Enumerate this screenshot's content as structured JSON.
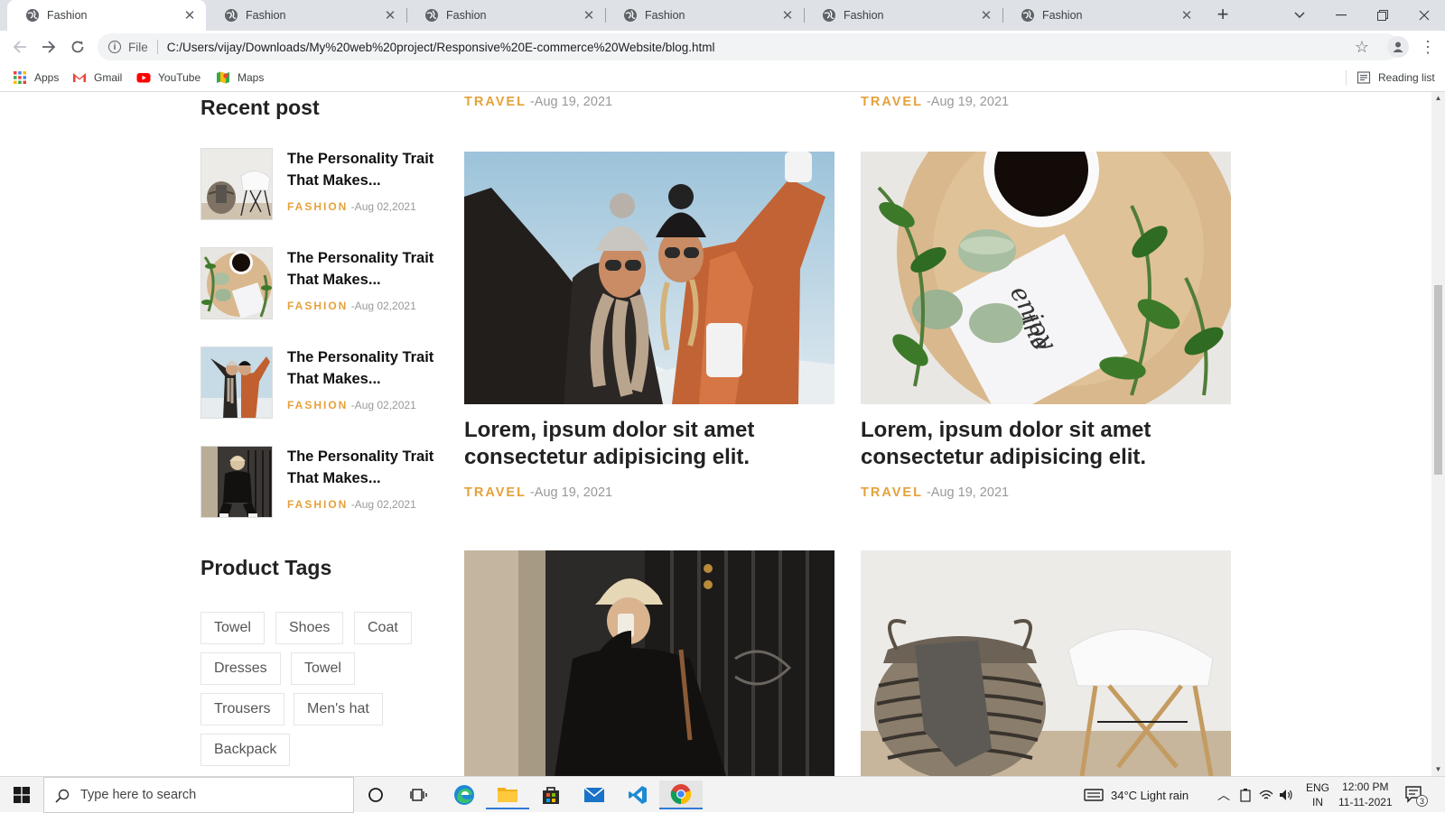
{
  "browser": {
    "tabs": [
      {
        "title": "Fashion",
        "active": true
      },
      {
        "title": "Fashion",
        "active": false
      },
      {
        "title": "Fashion",
        "active": false
      },
      {
        "title": "Fashion",
        "active": false
      },
      {
        "title": "Fashion",
        "active": false
      },
      {
        "title": "Fashion",
        "active": false
      }
    ],
    "omnibox": {
      "scheme_label": "File",
      "url": "C:/Users/vijay/Downloads/My%20web%20project/Responsive%20E-commerce%20Website/blog.html"
    },
    "bookmarks": [
      {
        "label": "Apps",
        "icon": "apps-grid-icon"
      },
      {
        "label": "Gmail",
        "icon": "gmail-icon"
      },
      {
        "label": "YouTube",
        "icon": "youtube-icon"
      },
      {
        "label": "Maps",
        "icon": "maps-icon"
      }
    ],
    "reading_list_label": "Reading list"
  },
  "page": {
    "recent_post": {
      "heading": "Recent post",
      "items": [
        {
          "title": "The Personality Trait That Makes...",
          "category": "FASHION",
          "date": "-Aug 02,2021",
          "image": "chair-basket"
        },
        {
          "title": "The Personality Trait That Makes...",
          "category": "FASHION",
          "date": "-Aug 02,2021",
          "image": "coffee-leaves"
        },
        {
          "title": "The Personality Trait That Makes...",
          "category": "FASHION",
          "date": "-Aug 02,2021",
          "image": "friends-snow"
        },
        {
          "title": "The Personality Trait That Makes...",
          "category": "FASHION",
          "date": "-Aug 02,2021",
          "image": "woman-black"
        }
      ]
    },
    "product_tags": {
      "heading": "Product Tags",
      "tags": [
        "Towel",
        "Shoes",
        "Coat",
        "Dresses",
        "Towel",
        "Trousers",
        "Men's hat",
        "Backpack"
      ]
    },
    "top_meta": [
      {
        "category": "TRAVEL",
        "date": "-Aug 19, 2021"
      },
      {
        "category": "TRAVEL",
        "date": "-Aug 19, 2021"
      }
    ],
    "posts": [
      {
        "title": "Lorem, ipsum dolor sit amet consectetur adipisicing elit.",
        "category": "TRAVEL",
        "date": "-Aug 19, 2021",
        "image": "friends-snow"
      },
      {
        "title": "Lorem, ipsum dolor sit amet consectetur adipisicing elit.",
        "category": "TRAVEL",
        "date": "-Aug 19, 2021",
        "image": "coffee-leaves"
      },
      {
        "image": "woman-black"
      },
      {
        "image": "chair-basket"
      }
    ],
    "colors": {
      "accent": "#e5a13a",
      "text": "#222222",
      "muted": "#999999"
    }
  },
  "taskbar": {
    "search_placeholder": "Type here to search",
    "weather": "34°C  Light rain",
    "lang_top": "ENG",
    "lang_bottom": "IN",
    "time": "12:00 PM",
    "date": "11-11-2021",
    "notification_count": "3"
  }
}
